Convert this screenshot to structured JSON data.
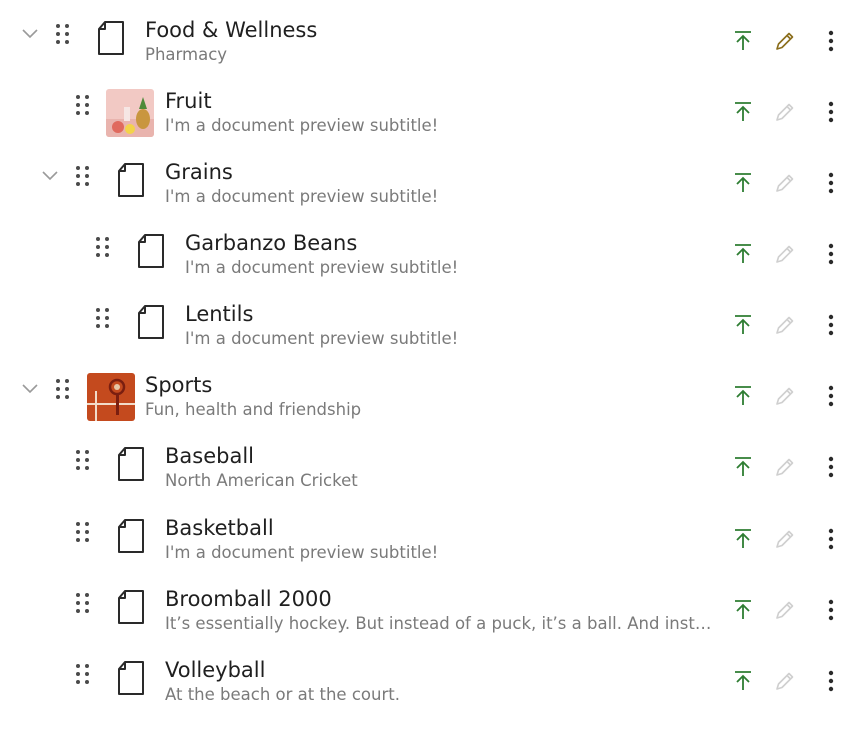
{
  "items": [
    {
      "title": "Food & Wellness",
      "subtitle": "Pharmacy",
      "media": "document",
      "collapsible": true,
      "edit_active": true
    },
    {
      "title": "Fruit",
      "subtitle": "I'm a document preview subtitle!",
      "media": "image-fruit",
      "collapsible": false,
      "edit_active": false
    },
    {
      "title": "Grains",
      "subtitle": "I'm a document preview subtitle!",
      "media": "document",
      "collapsible": true,
      "edit_active": false
    },
    {
      "title": "Garbanzo Beans",
      "subtitle": "I'm a document preview subtitle!",
      "media": "document",
      "collapsible": false,
      "edit_active": false
    },
    {
      "title": "Lentils",
      "subtitle": "I'm a document preview subtitle!",
      "media": "document",
      "collapsible": false,
      "edit_active": false
    },
    {
      "title": "Sports",
      "subtitle": "Fun, health and friendship",
      "media": "image-sports",
      "collapsible": true,
      "edit_active": false
    },
    {
      "title": "Baseball",
      "subtitle": "North American Cricket",
      "media": "document",
      "collapsible": false,
      "edit_active": false
    },
    {
      "title": "Basketball",
      "subtitle": "I'm a document preview subtitle!",
      "media": "document",
      "collapsible": false,
      "edit_active": false
    },
    {
      "title": "Broomball 2000",
      "subtitle": "It’s essentially hockey. But instead of a puck, it’s a ball. And instead …",
      "media": "document",
      "collapsible": false,
      "edit_active": false
    },
    {
      "title": "Volleyball",
      "subtitle": "At the beach or at the court.",
      "media": "document",
      "collapsible": false,
      "edit_active": false
    }
  ],
  "icons": {
    "collapse": "chevron-down-icon",
    "drag": "drag-handle-icon",
    "document": "document-icon",
    "publish": "publish-icon",
    "edit": "pencil-icon",
    "more": "more-vertical-icon"
  },
  "colors": {
    "publish": "#2e7d32",
    "edit_active": "#8a6d1b",
    "edit_inactive": "#cfcfcf",
    "title": "#1f1f1f",
    "subtitle": "#7a7a7a"
  }
}
